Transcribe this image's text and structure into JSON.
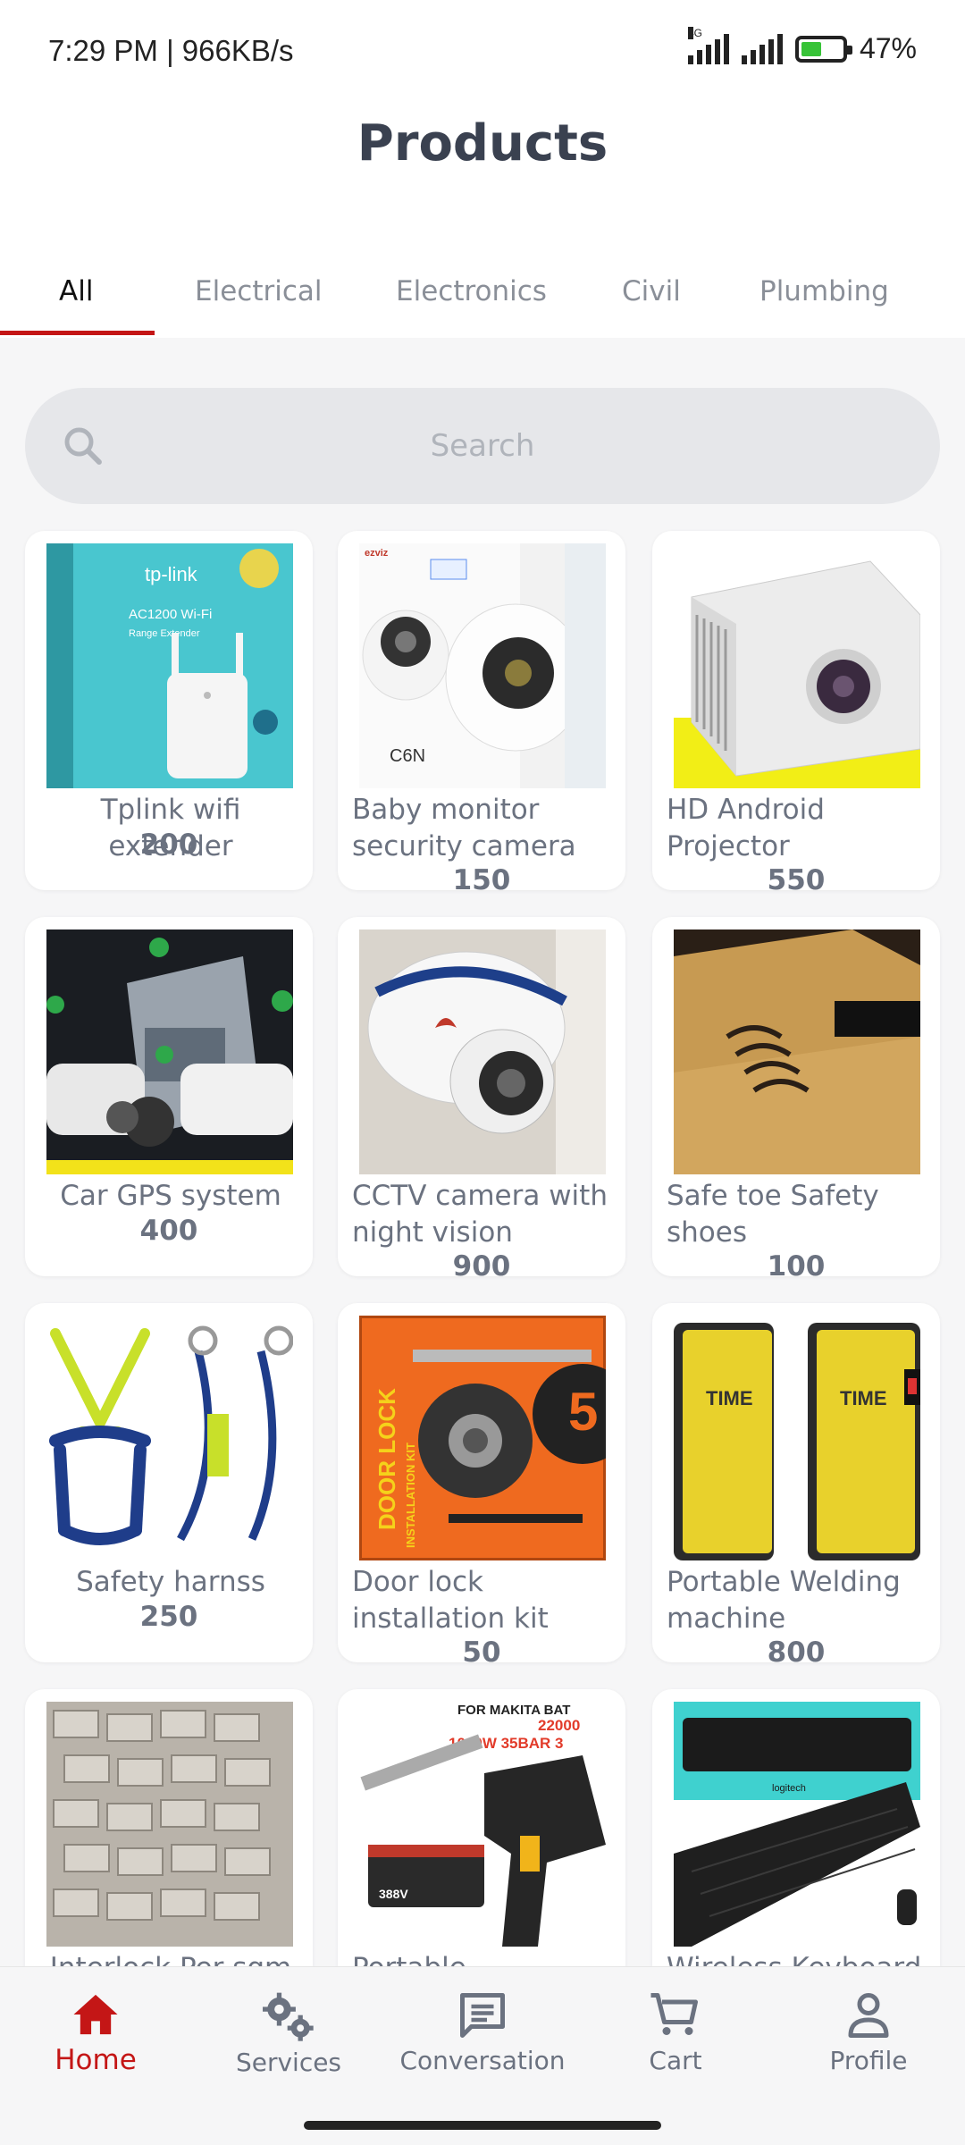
{
  "status_bar": {
    "time": "7:29 PM | 966KB/s",
    "network_tag": "4G",
    "battery_percent": "47%"
  },
  "header": {
    "title": "Products"
  },
  "tabs": [
    {
      "label": "All",
      "active": true
    },
    {
      "label": "Electrical",
      "active": false
    },
    {
      "label": "Electronics",
      "active": false
    },
    {
      "label": "Civil",
      "active": false
    },
    {
      "label": "Plumbing",
      "active": false
    }
  ],
  "search": {
    "placeholder": "Search",
    "value": ""
  },
  "products": [
    {
      "name": "Tplink wifi extender",
      "price": "200"
    },
    {
      "name": "Baby monitor security camera",
      "price": "150"
    },
    {
      "name": "HD Android Projector",
      "price": "550"
    },
    {
      "name": "Car GPS system",
      "price": "400"
    },
    {
      "name": "CCTV camera with night vision",
      "price": "900"
    },
    {
      "name": "Safe toe Safety shoes",
      "price": "100"
    },
    {
      "name": "Safety harnss",
      "price": "250"
    },
    {
      "name": "Door lock installation kit",
      "price": "50"
    },
    {
      "name": "Portable Welding machine",
      "price": "800"
    },
    {
      "name": "Interlock Per sqm",
      "price": ""
    },
    {
      "name": "Portable",
      "price": ""
    },
    {
      "name": "Wireless Keyboard",
      "price": ""
    }
  ],
  "image_text": {
    "tplink_brand": "tp-link",
    "tplink_model": "AC1200 Wi-Fi",
    "tplink_sub": "Range Extender",
    "ezviz_brand": "ezviz",
    "ezviz_model": "C6N",
    "door_lock_box": "DOOR LOCK",
    "door_lock_box2": "INSTALLATION KIT",
    "welder_brand": "TIME",
    "washer_title": "FOR MAKITA BAT",
    "washer_spec1": "22000",
    "washer_spec2": "1000W 35BAR 3",
    "washer_battery": "388V",
    "keyboard_brand": "logitech"
  },
  "bottom_nav": [
    {
      "label": "Home",
      "icon": "home-icon",
      "active": true
    },
    {
      "label": "Services",
      "icon": "gears-icon",
      "active": false
    },
    {
      "label": "Conversation",
      "icon": "chat-icon",
      "active": false
    },
    {
      "label": "Cart",
      "icon": "cart-icon",
      "active": false
    },
    {
      "label": "Profile",
      "icon": "person-icon",
      "active": false
    }
  ],
  "colors": {
    "accent": "#c41616",
    "title": "#3a4150",
    "text": "#6b7280",
    "background": "#f6f6f7"
  }
}
